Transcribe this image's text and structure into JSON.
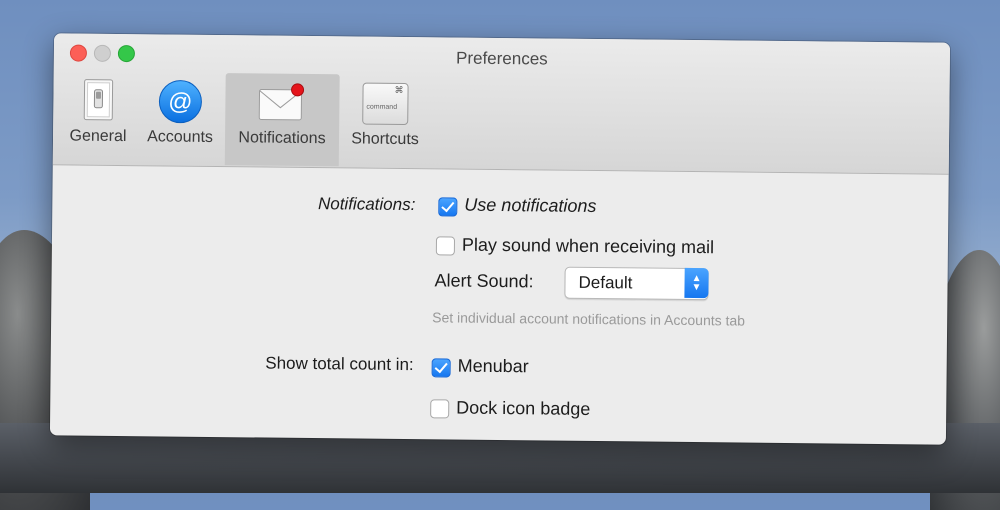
{
  "window": {
    "title": "Preferences"
  },
  "toolbar": {
    "tabs": [
      {
        "label": "General",
        "icon": "general-switch-icon"
      },
      {
        "label": "Accounts",
        "icon": "at-sign-icon"
      },
      {
        "label": "Notifications",
        "icon": "envelope-badge-icon",
        "selected": true
      },
      {
        "label": "Shortcuts",
        "icon": "command-key-icon"
      }
    ],
    "shortcut_key_text": "command"
  },
  "notifications": {
    "label": "Notifications:",
    "use_notifications": {
      "label": "Use notifications",
      "checked": true
    },
    "play_sound": {
      "label": "Play sound when receiving mail",
      "checked": false
    },
    "alert_sound": {
      "label": "Alert Sound:",
      "value": "Default"
    },
    "hint": "Set individual account notifications in Accounts tab"
  },
  "count": {
    "label": "Show total count in:",
    "menubar": {
      "label": "Menubar",
      "checked": true
    },
    "dock_badge": {
      "label": "Dock icon badge",
      "checked": false
    }
  },
  "colors": {
    "accent": "#1677f0",
    "close": "#fc5f57",
    "zoom": "#34c749",
    "badge": "#e5141b"
  }
}
